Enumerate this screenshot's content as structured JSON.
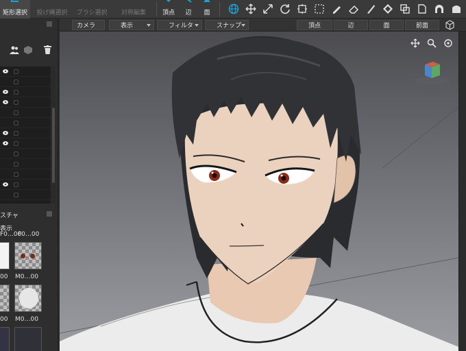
{
  "toolbar": {
    "rect_select": "矩形選択",
    "lasso_select": "投げ縄選択",
    "brush_select": "ブラシ選択",
    "symmetry_edit": "対称編集",
    "vertex": "頂点",
    "edge": "辺",
    "face": "面"
  },
  "viewbar": {
    "camera": "カメラ",
    "display": "表示",
    "filter": "フィルタ",
    "snap": "スナップ",
    "vertex": "頂点",
    "edge": "辺",
    "face": "面",
    "front": "前面"
  },
  "left_panel": {
    "texture_title": "スチャ",
    "display_label": "表示",
    "thumbnails": [
      {
        "caption": "F0…00"
      },
      {
        "caption": "00"
      },
      {
        "caption": "M0…00"
      },
      {
        "caption": "00"
      },
      {
        "caption": "M0…00"
      }
    ],
    "object_rows": [
      {
        "visible": true
      },
      {
        "visible": false
      },
      {
        "visible": true
      },
      {
        "visible": true
      },
      {
        "visible": false
      },
      {
        "visible": false
      },
      {
        "visible": true
      },
      {
        "visible": true
      },
      {
        "visible": false
      },
      {
        "visible": false
      },
      {
        "visible": false
      },
      {
        "visible": true
      },
      {
        "visible": false
      }
    ]
  },
  "colors": {
    "accent": "#1fa3d6",
    "panel": "#2e2e2e",
    "toolbar": "#3a3a3a"
  }
}
